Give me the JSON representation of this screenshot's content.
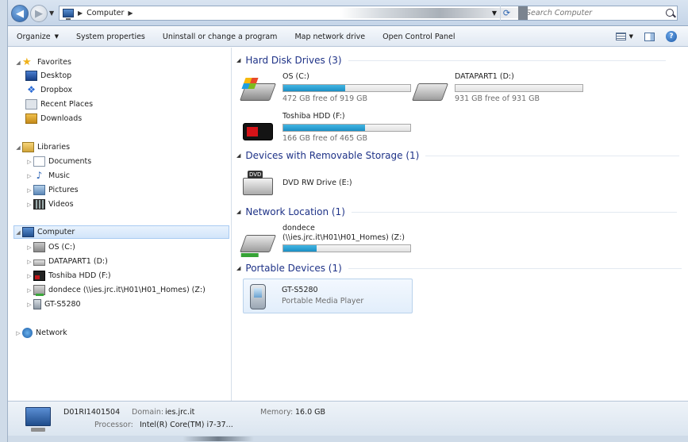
{
  "address": {
    "crumbs": [
      "Computer"
    ],
    "search_placeholder": "Search Computer"
  },
  "toolbar": {
    "organize": "Organize",
    "system_properties": "System properties",
    "uninstall": "Uninstall or change a program",
    "map_drive": "Map network drive",
    "control_panel": "Open Control Panel"
  },
  "nav": {
    "favorites": {
      "label": "Favorites",
      "items": [
        "Desktop",
        "Dropbox",
        "Recent Places",
        "Downloads"
      ]
    },
    "libraries": {
      "label": "Libraries",
      "items": [
        "Documents",
        "Music",
        "Pictures",
        "Videos"
      ]
    },
    "computer": {
      "label": "Computer",
      "items": [
        "OS (C:)",
        "DATAPART1 (D:)",
        "Toshiba HDD (F:)",
        "dondece (\\\\ies.jrc.it\\H01\\H01_Homes) (Z:)",
        "GT-S5280"
      ]
    },
    "network": {
      "label": "Network"
    }
  },
  "groups": {
    "hdd": "Hard Disk Drives (3)",
    "removable": "Devices with Removable Storage (1)",
    "network": "Network Location (1)",
    "portable": "Portable Devices (1)"
  },
  "drives": {
    "c": {
      "name": "OS (C:)",
      "free": "472 GB free of 919 GB",
      "used_fraction": 0.486
    },
    "d": {
      "name": "DATAPART1 (D:)",
      "free": "931 GB free of 931 GB",
      "used_fraction": 0.0
    },
    "f": {
      "name": "Toshiba HDD (F:)",
      "free": "166 GB free of 465 GB",
      "used_fraction": 0.643
    },
    "e": {
      "name": "DVD RW Drive (E:)"
    },
    "z": {
      "name_line1": "dondece",
      "name_line2": "(\\\\ies.jrc.it\\H01\\H01_Homes) (Z:)",
      "used_fraction": 0.26
    }
  },
  "portable": {
    "name": "GT-S5280",
    "type": "Portable Media Player"
  },
  "details": {
    "name": "D01RI1401504",
    "domain_label": "Domain:",
    "domain": "ies.jrc.it",
    "memory_label": "Memory:",
    "memory": "16.0 GB",
    "processor_label": "Processor:",
    "processor": "Intel(R) Core(TM) i7-37..."
  },
  "icons": {
    "back": "back-arrow-icon",
    "forward": "forward-arrow-icon",
    "refresh": "refresh-icon",
    "search": "search-icon",
    "help": "help-icon"
  }
}
